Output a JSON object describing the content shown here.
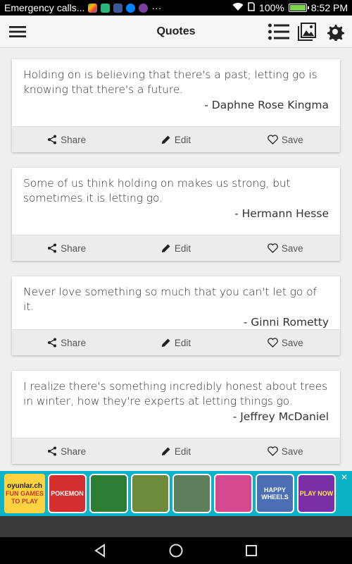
{
  "status_bar": {
    "carrier_text": "Emergency calls...",
    "notif_icons": [
      "play-store-icon",
      "chat-icon",
      "facebook-icon",
      "messenger-icon",
      "video-icon"
    ],
    "more_text": "···",
    "battery_percent_text": "100%",
    "battery_level": 1.0,
    "time": "8:52 PM"
  },
  "app_bar": {
    "title": "Quotes"
  },
  "quotes": [
    {
      "text": "Holding on is believing that there's a past; letting go is knowing that there's a future.",
      "author": "- Daphne Rose Kingma"
    },
    {
      "text": "Some of us think holding on makes us strong, but sometimes it is letting go.",
      "author": "- Hermann Hesse"
    },
    {
      "text": "Never love something so much that you can't let go of it.",
      "author": "- Ginni Rometty"
    },
    {
      "text": "I realize there's something incredibly honest about trees in winter, how they're experts at letting things go.",
      "author": "- Jeffrey McDaniel"
    }
  ],
  "card_actions": {
    "share": "Share",
    "edit": "Edit",
    "save": "Save"
  },
  "ad": {
    "brand_site": "oyunlar.ch",
    "brand_tagline": "FUN GAMES TO PLAY",
    "tiles": [
      "POKEMON",
      "",
      "",
      "",
      "",
      "",
      "HAPPY WHEELS",
      "PLAY NOW"
    ],
    "close_icon": "close-icon"
  },
  "colors": {
    "ad_background": "#0bb3c8",
    "battery_fill": "#7bd34a",
    "app_bar": "#f5f5f5",
    "card_action_bar": "#ececec"
  }
}
